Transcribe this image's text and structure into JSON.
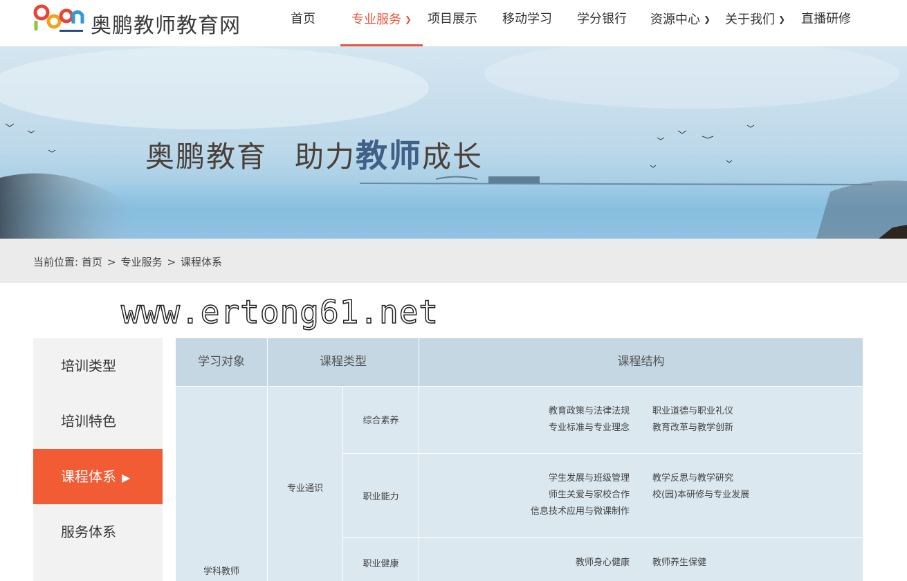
{
  "site": {
    "name": "奥鹏教师教育网"
  },
  "nav": {
    "items": [
      {
        "label": "首页",
        "dropdown": false
      },
      {
        "label": "专业服务",
        "dropdown": true,
        "active": true
      },
      {
        "label": "项目展示",
        "dropdown": false
      },
      {
        "label": "移动学习",
        "dropdown": false
      },
      {
        "label": "学分银行",
        "dropdown": false
      },
      {
        "label": "资源中心",
        "dropdown": true
      },
      {
        "label": "关于我们",
        "dropdown": true
      },
      {
        "label": "直播研修",
        "dropdown": false
      }
    ]
  },
  "banner": {
    "slogan_part1": "奥鹏教育",
    "slogan_part2a": "助力",
    "slogan_highlight": "教师",
    "slogan_part2b": "成长"
  },
  "breadcrumb": {
    "prefix": "当前位置:",
    "items": [
      "首页",
      "专业服务",
      "课程体系"
    ],
    "separator": ">"
  },
  "watermark": "www.ertong61.net",
  "sidebar": {
    "items": [
      {
        "label": "培训类型",
        "active": false
      },
      {
        "label": "培训特色",
        "active": false
      },
      {
        "label": "课程体系",
        "active": true
      },
      {
        "label": "服务体系",
        "active": false
      }
    ],
    "active_marker": "▶"
  },
  "table": {
    "headers": [
      "学习对象",
      "课程类型",
      "课程结构"
    ],
    "audience": "学科教师",
    "category": "专业通识",
    "rows": [
      {
        "sub": "综合素养",
        "left": [
          "教育政策与法律法规",
          "专业标准与专业理念"
        ],
        "right": [
          "职业道德与职业礼仪",
          "教育改革与教学创新"
        ]
      },
      {
        "sub": "职业能力",
        "left": [
          "学生发展与班级管理",
          "师生关爱与家校合作",
          "信息技术应用与微课制作"
        ],
        "right": [
          "教学反思与教学研究",
          "校(园)本研修与专业发展"
        ]
      },
      {
        "sub": "职业健康",
        "left": [
          "教师身心健康"
        ],
        "right": [
          "教师养生保健"
        ]
      }
    ]
  },
  "colors": {
    "accent": "#e8563a",
    "sidebar_active": "#f25c34",
    "table_header": "#c4d7e3"
  },
  "icons": {
    "nav_dropdown": "chevron-down-icon",
    "sidebar_marker": "triangle-right-icon"
  }
}
